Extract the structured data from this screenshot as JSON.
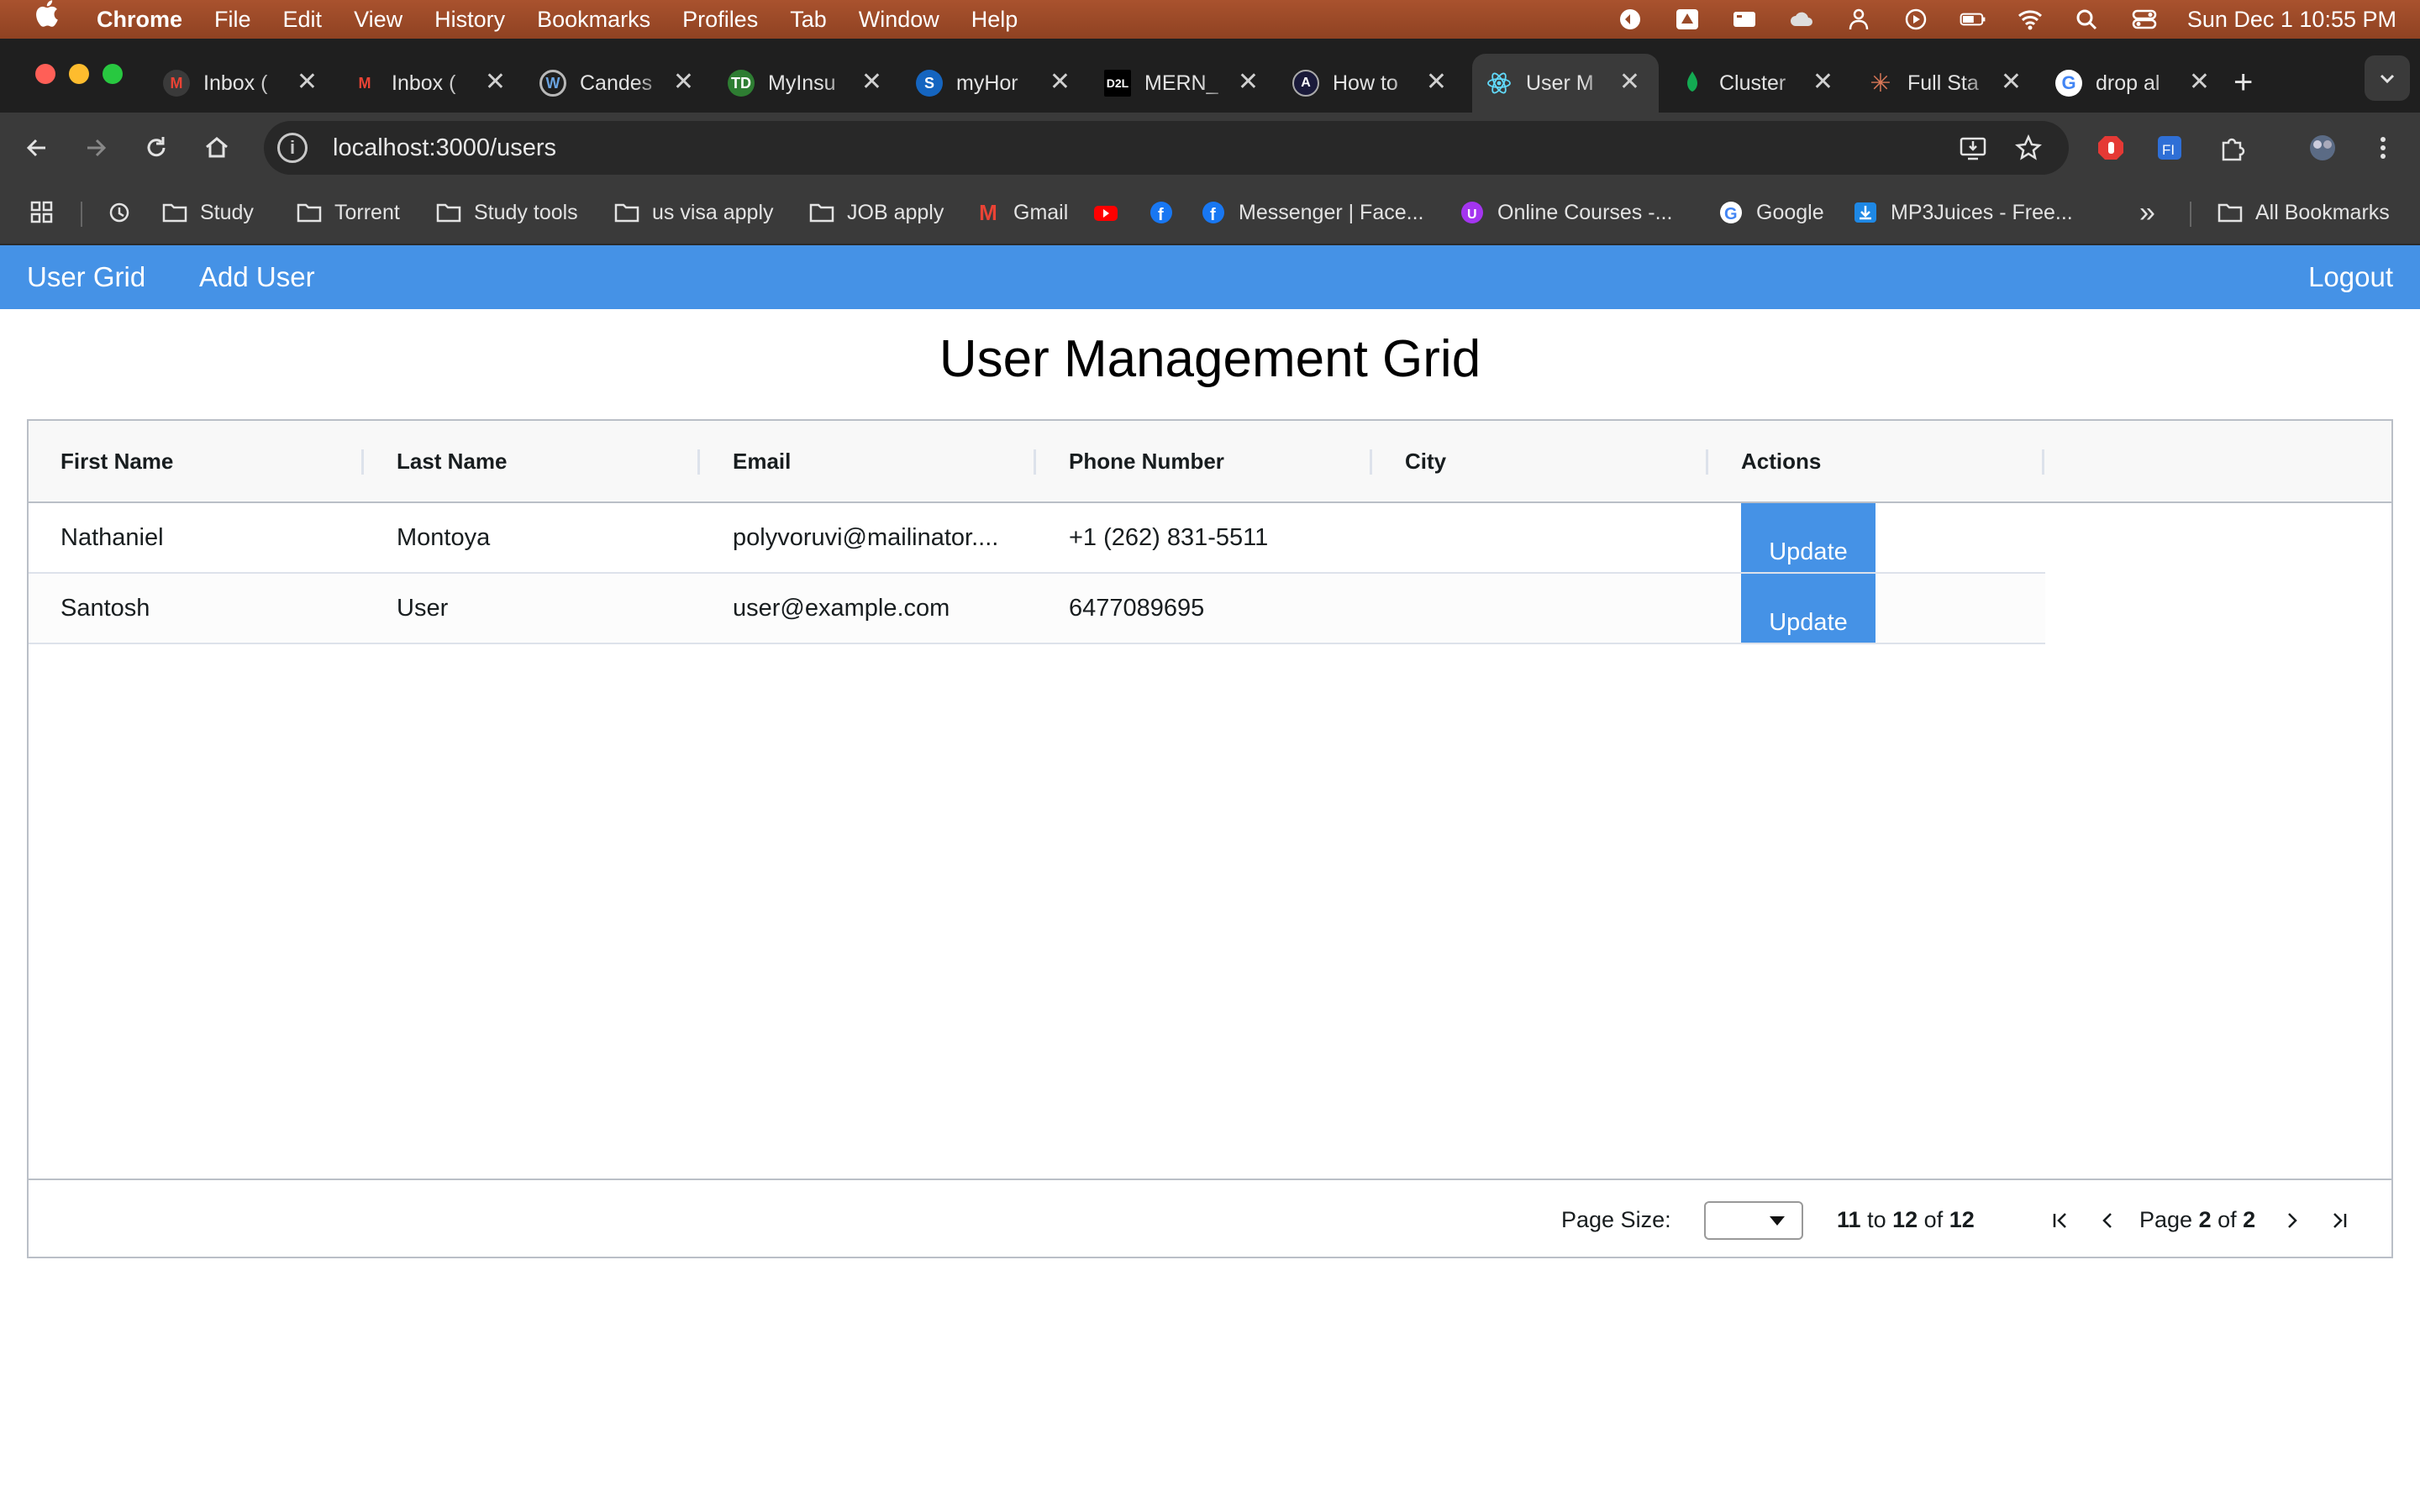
{
  "menubar": {
    "apple": "",
    "app_name": "Chrome",
    "items": [
      "File",
      "Edit",
      "View",
      "History",
      "Bookmarks",
      "Profiles",
      "Tab",
      "Window",
      "Help"
    ],
    "clock": "Sun Dec 1  10:55 PM"
  },
  "tabs": [
    {
      "title": "Inbox (",
      "icon": "gmail-icon"
    },
    {
      "title": "Inbox (",
      "icon": "gmail-icon"
    },
    {
      "title": "Candes",
      "icon": "candescent-icon"
    },
    {
      "title": "MyInsu",
      "icon": "td-icon"
    },
    {
      "title": "myHor",
      "icon": "myhorizon-icon"
    },
    {
      "title": "MERN_",
      "icon": "d2l-icon"
    },
    {
      "title": "How to",
      "icon": "angular-icon"
    },
    {
      "title": "User M",
      "icon": "react-icon",
      "active": true
    },
    {
      "title": "Cluster",
      "icon": "mongodb-icon"
    },
    {
      "title": "Full Sta",
      "icon": "claude-icon"
    },
    {
      "title": "drop al",
      "icon": "google-icon"
    }
  ],
  "tab_close_glyph": "✕",
  "new_tab_glyph": "+",
  "address_bar": {
    "url": "localhost:3000/users",
    "info_glyph": "i"
  },
  "bookmarks": {
    "items": [
      "Study",
      "Torrent",
      "Study tools",
      "us visa apply",
      "JOB apply",
      "Gmail",
      "Messenger | Face...",
      "Online Courses -...",
      "Google",
      "MP3Juices - Free..."
    ],
    "overflow_glyph": "»",
    "all_bookmarks": "All Bookmarks"
  },
  "app_nav": {
    "user_grid": "User Grid",
    "add_user": "Add User",
    "logout": "Logout"
  },
  "page_title": "User Management Grid",
  "grid": {
    "columns": [
      "First Name",
      "Last Name",
      "Email",
      "Phone Number",
      "City",
      "Actions"
    ],
    "rows": [
      {
        "first": "Nathaniel",
        "last": "Montoya",
        "email": "polyvoruvi@mailinator....",
        "phone": "+1 (262) 831-5511",
        "city": "",
        "action": "Update"
      },
      {
        "first": "Santosh",
        "last": "User",
        "email": "user@example.com",
        "phone": "6477089695",
        "city": "",
        "action": "Update"
      }
    ],
    "footer": {
      "page_size_label": "Page Size:",
      "page_size_value": "",
      "range_from": "11",
      "range_to_word": "to",
      "range_to": "12",
      "of_word": "of",
      "total": "12",
      "page_word": "Page",
      "page_current": "2",
      "page_total": "2"
    }
  },
  "colors": {
    "nav_bar": "#4592e6",
    "update_button": "#4592e6",
    "menubar": "#9a4a28"
  }
}
